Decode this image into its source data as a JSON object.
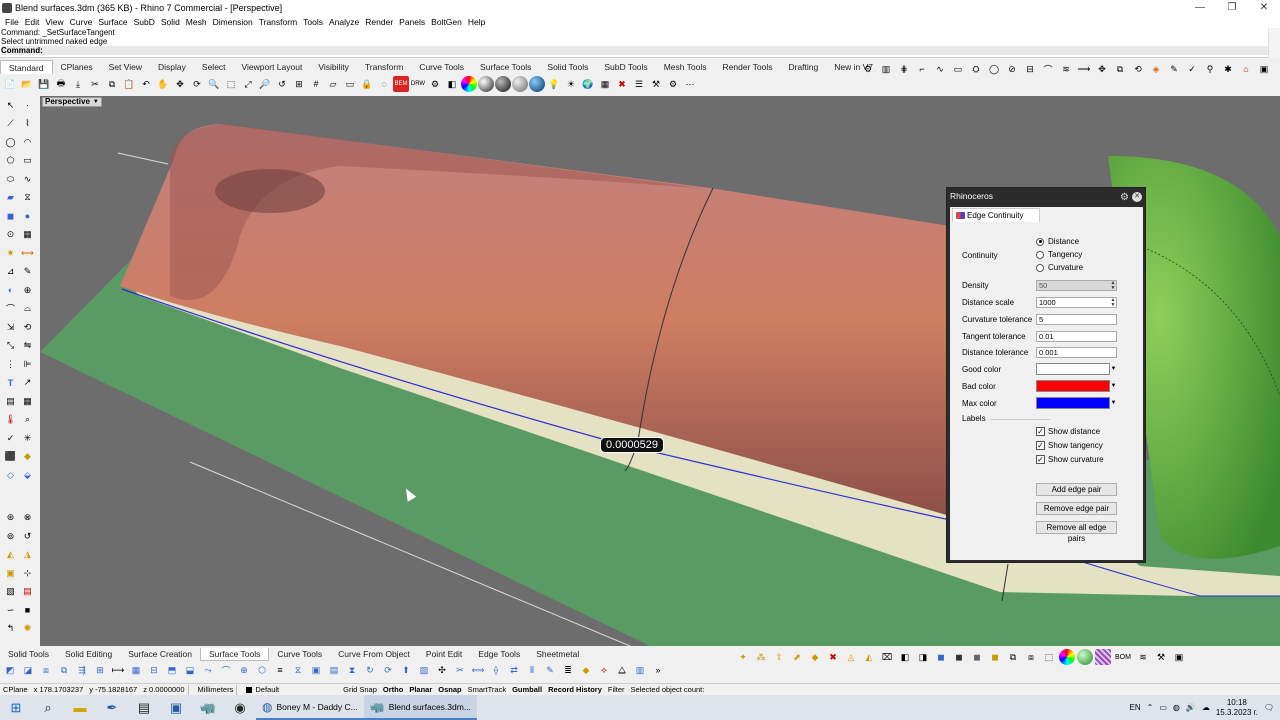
{
  "window": {
    "title": "Blend surfaces.3dm (365 KB) - Rhino 7 Commercial - [Perspective]",
    "controls": [
      "—",
      "❐",
      "✕"
    ]
  },
  "menu": [
    "File",
    "Edit",
    "View",
    "Curve",
    "Surface",
    "SubD",
    "Solid",
    "Mesh",
    "Dimension",
    "Transform",
    "Tools",
    "Analyze",
    "Render",
    "Panels",
    "BoltGen",
    "Help"
  ],
  "command": {
    "history": [
      "Command: _SetSurfaceTangent",
      "Select untrimmed naked edge"
    ],
    "prompt": "Command:"
  },
  "toolbar_tabs": [
    "Standard",
    "CPlanes",
    "Set View",
    "Display",
    "Select",
    "Viewport Layout",
    "Visibility",
    "Transform",
    "Curve Tools",
    "Surface Tools",
    "Solid Tools",
    "SubD Tools",
    "Mesh Tools",
    "Render Tools",
    "Drafting",
    "New in V7"
  ],
  "toolbar_icon_labels": {
    "bad_edge": "BEM",
    "drw": "DRW"
  },
  "viewport": {
    "name": "Perspective",
    "edge_label": "0.0000529"
  },
  "panel": {
    "title": "Rhinoceros",
    "tab": "Edge Continuity",
    "continuity_label": "Continuity",
    "continuity_options": [
      "Distance",
      "Tangency",
      "Curvature"
    ],
    "continuity_selected": "Distance",
    "density_label": "Density",
    "density_value": "50",
    "distance_scale_label": "Distance scale",
    "distance_scale_value": "1000",
    "curvature_tol_label": "Curvature tolerance",
    "curvature_tol_value": "5",
    "tangent_tol_label": "Tangent tolerance",
    "tangent_tol_value": "0.01",
    "distance_tol_label": "Distance tolerance",
    "distance_tol_value": "0.001",
    "good_color_label": "Good color",
    "bad_color_label": "Bad color",
    "max_color_label": "Max color",
    "good_color": "#ffffff",
    "bad_color": "#ff0000",
    "max_color": "#0000ff",
    "labels_heading": "Labels",
    "show_distance": "Show distance",
    "show_tangency": "Show tangency",
    "show_curvature": "Show curvature",
    "add_pair": "Add edge pair",
    "remove_pair": "Remove edge pair",
    "remove_all": "Remove all edge pairs"
  },
  "bottom_tabs": [
    "Solid Tools",
    "Solid Editing",
    "Surface Creation",
    "Surface Tools",
    "Curve Tools",
    "Curve From Object",
    "Point Edit",
    "Edge Tools",
    "Sheetmetal"
  ],
  "bottom_icon_label": "BOM",
  "status": {
    "cplane": "CPlane",
    "x": "x 178.1703237",
    "y": "y -75.1828167",
    "z": "z 0.0000000",
    "units": "Millimeters",
    "layer": "Default",
    "grid_snap": "Grid Snap",
    "ortho": "Ortho",
    "planar": "Planar",
    "osnap": "Osnap",
    "smarttrack": "SmartTrack",
    "gumball": "Gumball",
    "record_history": "Record History",
    "filter": "Filter",
    "selected": "Selected object count:"
  },
  "taskbar": {
    "apps": [
      "Boney M - Daddy C...",
      "Blend surfaces.3dm..."
    ],
    "lang": "EN",
    "time": "10:18",
    "date": "15.3.2023 г."
  }
}
